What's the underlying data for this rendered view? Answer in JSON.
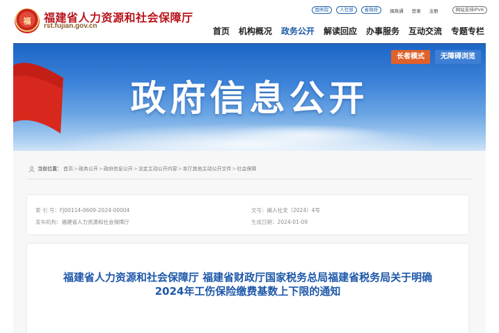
{
  "header": {
    "site_name": "福建省人力资源和社会保障厅",
    "site_domain": "rst.fujian.gov.cn",
    "emblem_text": "福",
    "top_pills": [
      "国务院",
      "人社部",
      "省政府"
    ],
    "top_links": [
      "闽政通",
      "登录",
      "注册"
    ],
    "ipv6_label": "网站支持IPV6"
  },
  "nav": {
    "items": [
      "首页",
      "机构概况",
      "政务公开",
      "解读回应",
      "办事服务",
      "互动交流",
      "专题专栏"
    ],
    "active": "政务公开",
    "active_color": "#1958a5"
  },
  "banner": {
    "title": "政府信息公开",
    "elder_mode": "长者模式",
    "accessible_browse": "无障碍浏览",
    "elder_color": "#e1612a",
    "accessible_color": "#3d7fd4"
  },
  "breadcrumb": {
    "label": "当前位置：",
    "items": [
      "首页",
      "政务公开",
      "政府信息公开",
      "法定主动公开内容",
      "本厅其他主动公开文件",
      "社会保障"
    ],
    "separator": ">"
  },
  "meta": {
    "index_key": "索 引 号：",
    "index_value": "FJ00114-0609-2024-00004",
    "doc_no_key": "文号：",
    "doc_no_value": "闽人社文〔2024〕4号",
    "publisher_key": "发布机构：",
    "publisher_value": "福建省人力资源和社会保障厅",
    "date_key": "生成日期：",
    "date_value": "2024-01-09"
  },
  "document": {
    "title_line1": "福建省人力资源和社会保障厅 福建省财政厅国家税务总局福建省税务局关于明确",
    "title_line2": "2024年工伤保险缴费基数上下限的通知",
    "title_color": "#1d57a8"
  }
}
